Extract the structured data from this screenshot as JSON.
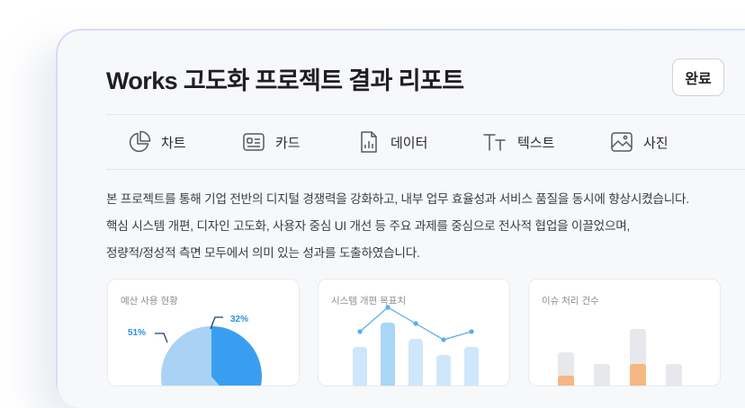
{
  "header": {
    "title": "Works 고도화 프로젝트 결과 리포트",
    "done_label": "완료"
  },
  "toolbar": {
    "items": [
      {
        "label": "차트",
        "icon": "pie-chart-icon"
      },
      {
        "label": "카드",
        "icon": "id-card-icon"
      },
      {
        "label": "데이터",
        "icon": "data-file-icon"
      },
      {
        "label": "텍스트",
        "icon": "text-icon"
      },
      {
        "label": "사진",
        "icon": "image-icon"
      }
    ]
  },
  "body": {
    "lines": [
      "본 프로젝트를 통해 기업 전반의 디지털 경쟁력을 강화하고, 내부 업무 효율성과 서비스 품질을 동시에 향상시켰습니다.",
      "핵심 시스템 개편, 디자인 고도화, 사용자 중심 UI 개선 등 주요 과제를 중심으로 전사적 협업을 이끌었으며,",
      "정량적/정성적 측면 모두에서 의미 있는 성과를 도출하였습니다."
    ]
  },
  "cards": [
    {
      "title": "예산 사용 현황",
      "chart_data": {
        "type": "pie",
        "labels": [
          "51%",
          "32%"
        ],
        "values": [
          51,
          32
        ],
        "colors": [
          "#a9d2f5",
          "#3a9ef0"
        ]
      }
    },
    {
      "title": "시스템 개편 목표치",
      "chart_data": {
        "type": "bar",
        "overlay": "line",
        "bar_values": [
          5,
          8,
          6,
          4,
          5
        ],
        "line_values": [
          6,
          9,
          7,
          5,
          6
        ],
        "colors": [
          "#cfe7fb",
          "#a9d6f7",
          "#56aef0"
        ]
      }
    },
    {
      "title": "이슈 처리 건수",
      "chart_data": {
        "type": "bar",
        "stacked": true,
        "series": [
          {
            "values": [
              1,
              0,
              2,
              0
            ]
          },
          {
            "values": [
              2,
              2,
              3,
              2
            ]
          }
        ],
        "colors": [
          "#f6b783",
          "#e7e8ec"
        ]
      }
    }
  ]
}
